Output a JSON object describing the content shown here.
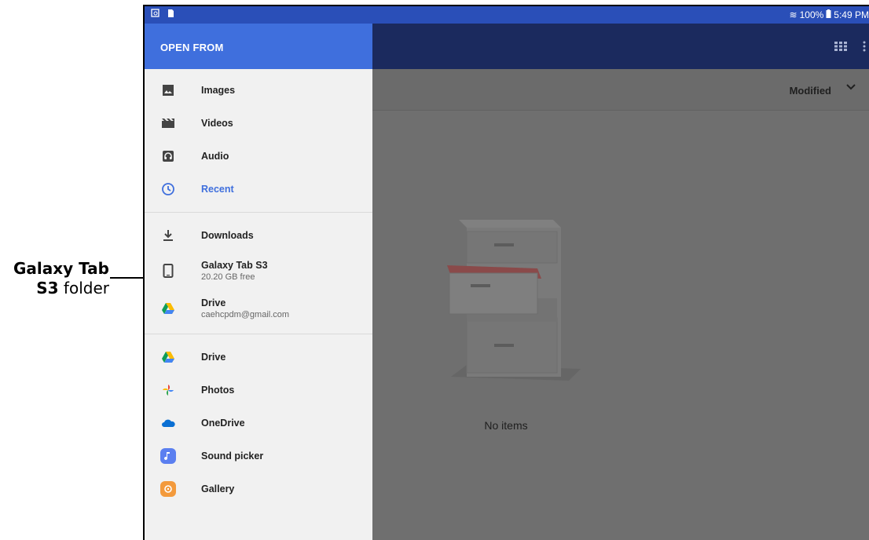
{
  "callout": {
    "line1": "Galaxy Tab",
    "line2_bold": "S3",
    "line2_rest": " folder"
  },
  "status": {
    "wifi": "≋",
    "battery": "100%",
    "time": "5:49 PM"
  },
  "drawer": {
    "title": "OPEN FROM",
    "group1": [
      {
        "label": "Images",
        "icon": "image-icon"
      },
      {
        "label": "Videos",
        "icon": "video-icon"
      },
      {
        "label": "Audio",
        "icon": "audio-icon"
      },
      {
        "label": "Recent",
        "icon": "clock-icon",
        "active": true
      }
    ],
    "group2": [
      {
        "label": "Downloads",
        "icon": "download-icon"
      },
      {
        "label": "Galaxy Tab S3",
        "sub": "20.20 GB free",
        "icon": "tablet-icon"
      },
      {
        "label": "Drive",
        "sub": "caehcpdm@gmail.com",
        "icon": "drive-icon"
      }
    ],
    "group3": [
      {
        "label": "Drive",
        "icon": "drive-icon"
      },
      {
        "label": "Photos",
        "icon": "photos-icon"
      },
      {
        "label": "OneDrive",
        "icon": "onedrive-icon"
      },
      {
        "label": "Sound picker",
        "icon": "sound-picker-icon"
      },
      {
        "label": "Gallery",
        "icon": "gallery-icon"
      }
    ]
  },
  "sort": {
    "label": "Modified"
  },
  "empty": {
    "message": "No items"
  },
  "colors": {
    "statusbar": "#2a4fb8",
    "appbar": "#1b2a5e",
    "drawer_header": "#3f6fdd",
    "active": "#3f6fdd"
  }
}
